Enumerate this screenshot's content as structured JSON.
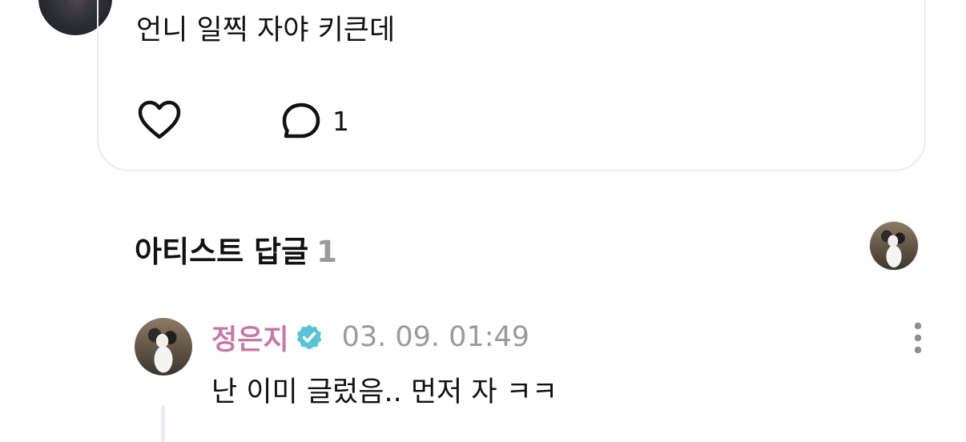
{
  "post": {
    "text": "언니 일찍 자야 키큰데",
    "like_icon": "heart-outline-icon",
    "comment_icon": "speech-bubble-icon",
    "comment_count": "1"
  },
  "artist_reply_section": {
    "title": "아티스트 답글",
    "count": "1"
  },
  "reply": {
    "author": "정은지",
    "verified_icon": "verified-badge-icon",
    "verified_color": "#5bc2d6",
    "author_color": "#c47aa8",
    "timestamp": "03. 09. 01:49",
    "text": "난 이미 글렀음.. 먼저 자 ㅋㅋ",
    "more_icon": "vertical-dots-icon"
  }
}
